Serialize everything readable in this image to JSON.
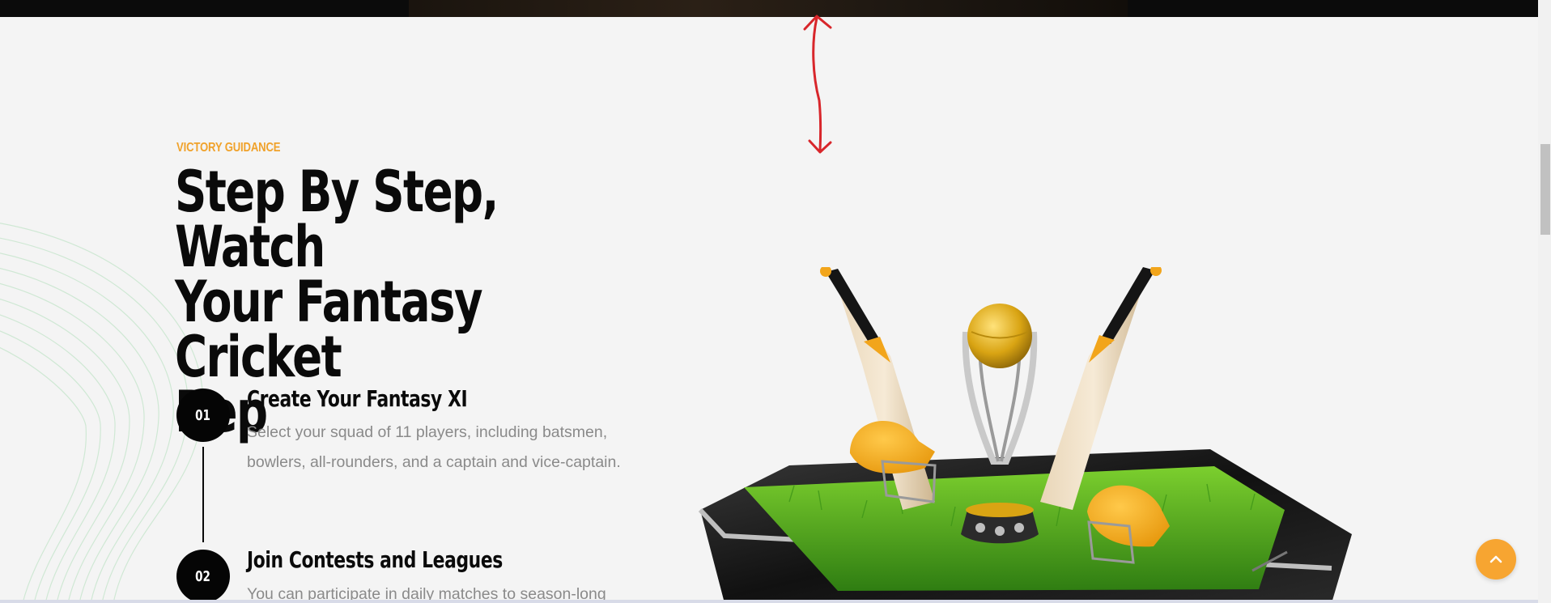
{
  "section": {
    "eyebrow": "VICTORY GUIDANCE",
    "heading_line1": "Step By Step, Watch",
    "heading_line2": "Your Fantasy Cricket",
    "heading_line3": "Rep"
  },
  "steps": [
    {
      "number": "01",
      "title": "Create Your Fantasy XI",
      "desc_line1": "Select your squad of 11 players, including batsmen,",
      "desc_line2": "bowlers, all-rounders, and a captain and vice-captain."
    },
    {
      "number": "02",
      "title": "Join Contests and Leagues",
      "desc_line1": "You can participate in daily matches to season-long"
    }
  ],
  "colors": {
    "accent": "#f0a22b",
    "scroll_button": "#f7a531",
    "heading": "#0a0a0a",
    "body_text": "#8a8a8a",
    "background": "#f4f4f4"
  },
  "icons": {
    "scroll_top": "chevron-up-icon",
    "annotation": "double-arrow-icon"
  }
}
